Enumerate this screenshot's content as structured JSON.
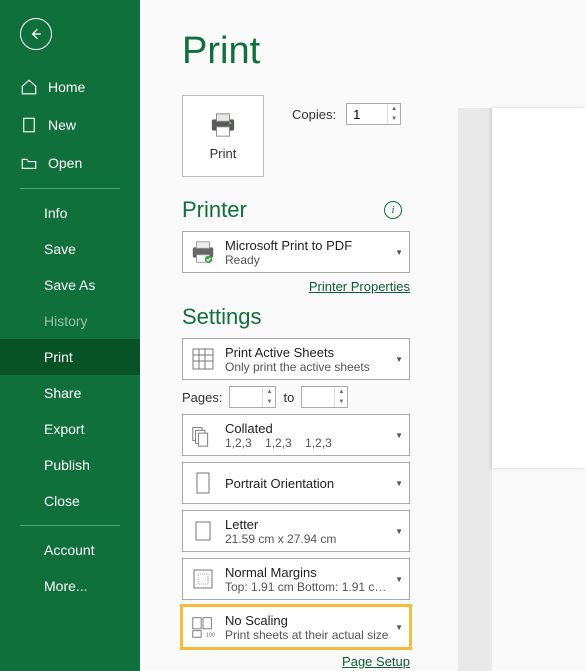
{
  "sidebar": {
    "home": "Home",
    "new": "New",
    "open": "Open",
    "info": "Info",
    "save": "Save",
    "saveAs": "Save As",
    "history": "History",
    "print": "Print",
    "share": "Share",
    "export": "Export",
    "publish": "Publish",
    "close": "Close",
    "account": "Account",
    "more": "More..."
  },
  "main": {
    "title": "Print",
    "printTile": "Print",
    "copiesLabel": "Copies:",
    "copiesValue": "1",
    "printerHeading": "Printer",
    "printer": {
      "name": "Microsoft Print to PDF",
      "status": "Ready"
    },
    "printerProps": "Printer Properties",
    "settingsHeading": "Settings",
    "activeSheets": {
      "line1": "Print Active Sheets",
      "line2": "Only print the active sheets"
    },
    "pagesLabel": "Pages:",
    "to": "to",
    "collated": {
      "line1": "Collated",
      "line2": "1,2,3    1,2,3    1,2,3"
    },
    "orientation": {
      "line1": "Portrait Orientation"
    },
    "paper": {
      "line1": "Letter",
      "line2": "21.59 cm x 27.94 cm"
    },
    "margins": {
      "line1": "Normal Margins",
      "line2": "Top: 1.91 cm Bottom: 1.91 c…"
    },
    "scaling": {
      "line1": "No Scaling",
      "line2": "Print sheets at their actual size"
    },
    "pageSetup": "Page Setup"
  }
}
